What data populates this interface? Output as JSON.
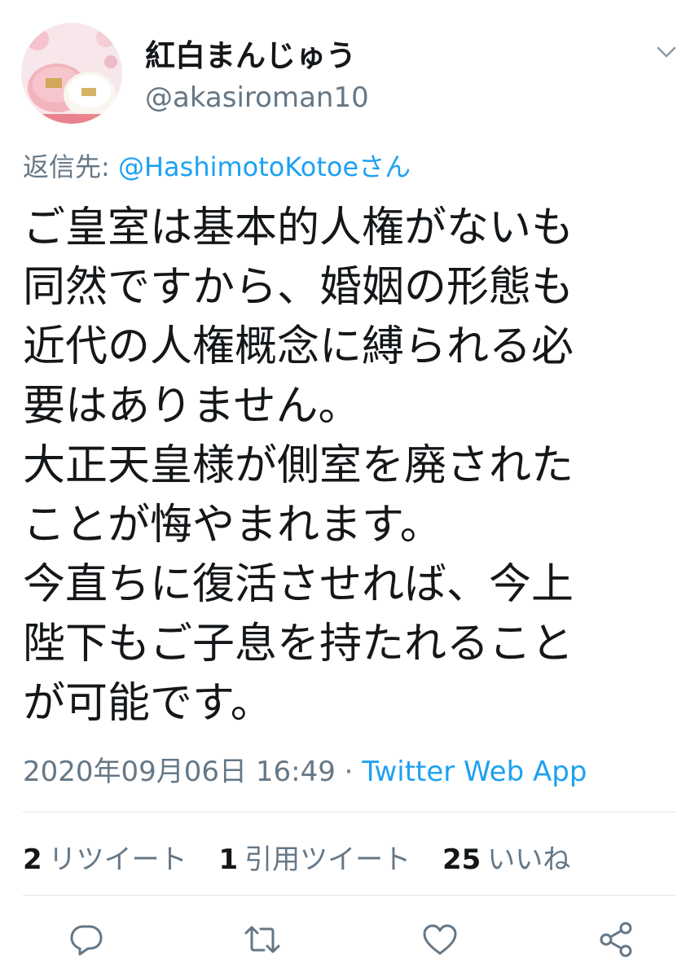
{
  "user": {
    "display_name": "紅白まんじゅう",
    "handle": "@akasiroman10"
  },
  "reply": {
    "prefix": "返信先: ",
    "mention": "@HashimotoKotoeさん"
  },
  "body_lines": [
    "ご皇室は基本的人権がないも",
    "同然ですから、婚姻の形態も",
    "近代の人権概念に縛られる必",
    "要はありません。",
    "大正天皇様が側室を廃された",
    "ことが悔やまれます。",
    "今直ちに復活させれば、今上",
    "陛下もご子息を持たれること",
    "が可能です。"
  ],
  "meta": {
    "timestamp": "2020年09月06日 16:49",
    "separator": " · ",
    "source": "Twitter Web App"
  },
  "stats": {
    "retweets": {
      "count": "2",
      "label": "リツイート"
    },
    "quotes": {
      "count": "1",
      "label": "引用ツイート"
    },
    "likes": {
      "count": "25",
      "label": "いいね"
    }
  },
  "actions": [
    "reply-icon",
    "retweet-icon",
    "like-icon",
    "share-icon"
  ],
  "colors": {
    "text": "#14171a",
    "secondary": "#657786",
    "link": "#1da1f2",
    "divider": "#dfe3e7"
  }
}
